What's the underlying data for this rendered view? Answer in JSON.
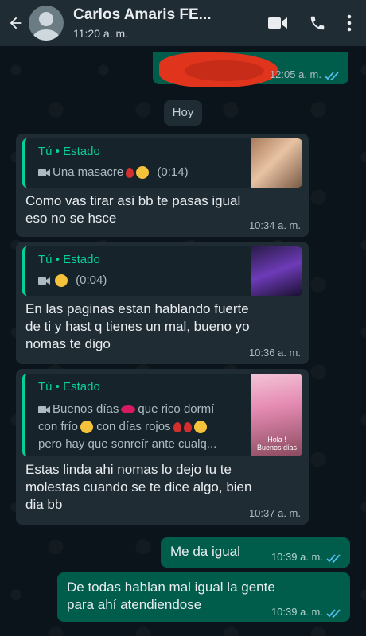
{
  "header": {
    "contact_name": "Carlos Amaris FE...",
    "last_seen": "11:20 a. m."
  },
  "top_partial": {
    "time": "12:05 a. m."
  },
  "day_divider": "Hoy",
  "messages": [
    {
      "direction": "incoming",
      "quote_title": "Tú • Estado",
      "quote_lines": [
        "Una masacre",
        "(0:14)"
      ],
      "text_lines": [
        "Como vas tirar asi bb te pasas igual",
        "eso no se hsce"
      ],
      "time": "10:34 a. m."
    },
    {
      "direction": "incoming",
      "quote_title": "Tú • Estado",
      "quote_lines": [
        "(0:04)"
      ],
      "text_lines": [
        "En las paginas estan hablando fuerte",
        "de ti y hast q tienes un mal, bueno yo",
        "nomas te digo"
      ],
      "time": "10:36 a. m."
    },
    {
      "direction": "incoming",
      "quote_title": "Tú • Estado",
      "quote_lines": [
        "Buenos días",
        "que rico dormí",
        "con frío",
        "con días rojos",
        "pero hay que sonreír ante cualq..."
      ],
      "thumb_caption": "Hola ! Buenos días",
      "text_lines": [
        "Estas linda ahi nomas lo dejo tu te",
        "molestas cuando se te dice algo, bien",
        "dia bb"
      ],
      "time": "10:37 a. m."
    },
    {
      "direction": "outgoing",
      "text_lines": [
        "Me da igual"
      ],
      "time": "10:39 a. m."
    },
    {
      "direction": "outgoing",
      "text_lines": [
        "De todas hablan mal igual la gente",
        "para ahí atendiendose"
      ],
      "time": "10:39 a. m."
    }
  ],
  "icons": [
    "back-arrow-icon",
    "avatar",
    "video-call-icon",
    "phone-icon",
    "more-options-icon",
    "video-camera-icon",
    "read-ticks-icon"
  ],
  "colors": {
    "header": "#1f2c34",
    "incoming": "#1f2c34",
    "outgoing": "#005c4b",
    "accent": "#06cf9c",
    "ticks": "#53bdeb"
  }
}
